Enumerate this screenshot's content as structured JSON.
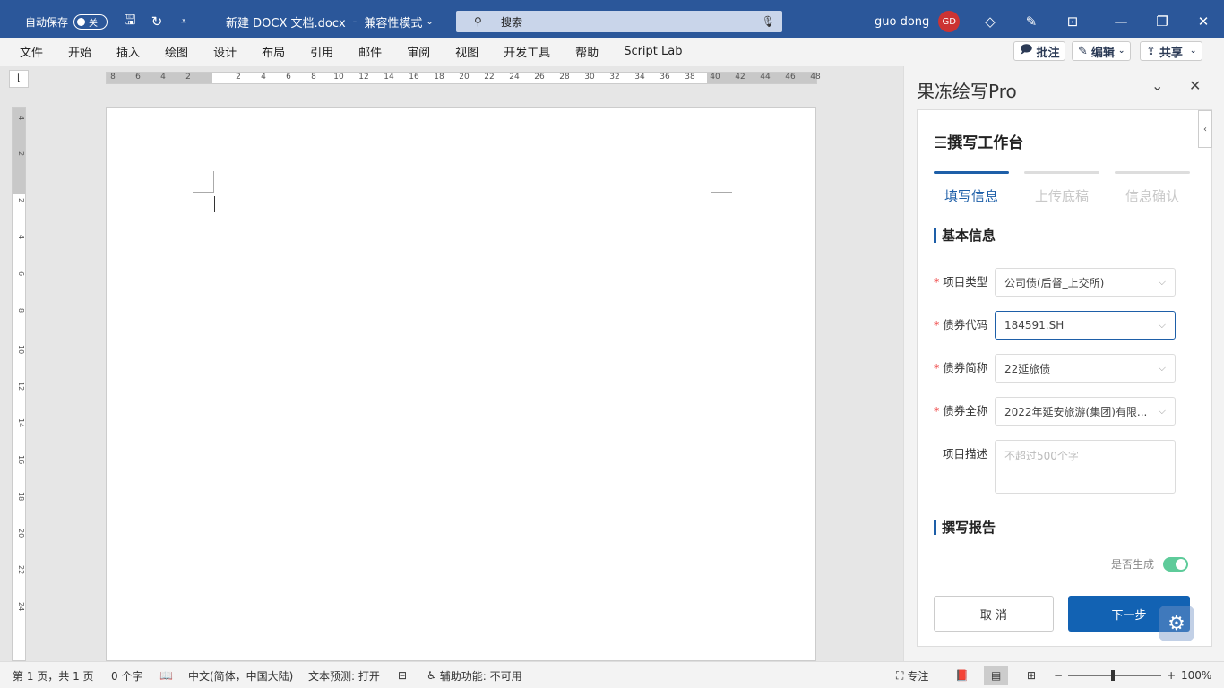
{
  "titlebar": {
    "autosave_label": "自动保存",
    "autosave_state": "关",
    "doc_name": "新建 DOCX 文档.docx",
    "separator": "-",
    "mode": "兼容性模式",
    "search_placeholder": "搜索",
    "user_name": "guo dong",
    "avatar_initials": "GD"
  },
  "ribbon": {
    "tabs": [
      "文件",
      "开始",
      "插入",
      "绘图",
      "设计",
      "布局",
      "引用",
      "邮件",
      "审阅",
      "视图",
      "开发工具",
      "帮助",
      "Script Lab"
    ],
    "comment_btn": "批注",
    "edit_btn": "编辑",
    "share_btn": "共享"
  },
  "ruler": {
    "h_numbers": [
      "8",
      "6",
      "4",
      "2",
      "2",
      "4",
      "6",
      "8",
      "10",
      "12",
      "14",
      "16",
      "18",
      "20",
      "22",
      "24",
      "26",
      "28",
      "30",
      "32",
      "34",
      "36",
      "38",
      "40",
      "42",
      "44",
      "46",
      "48"
    ],
    "v_numbers": [
      "4",
      "2",
      "2",
      "4",
      "6",
      "8",
      "10",
      "12",
      "14",
      "16",
      "18",
      "20",
      "22",
      "24"
    ]
  },
  "pane": {
    "title": "果冻绘写Pro",
    "work_title": "撰写工作台",
    "steps": [
      {
        "label": "填写信息",
        "active": true
      },
      {
        "label": "上传底稿",
        "active": false
      },
      {
        "label": "信息确认",
        "active": false
      }
    ],
    "section_basic": "基本信息",
    "fields": [
      {
        "label": "项目类型",
        "value": "公司债(后督_上交所)",
        "required": true
      },
      {
        "label": "债券代码",
        "value": "184591.SH",
        "required": true
      },
      {
        "label": "债券简称",
        "value": "22延旅债",
        "required": true
      },
      {
        "label": "债券全称",
        "value": "2022年延安旅游(集团)有限...",
        "required": true
      }
    ],
    "desc_label": "项目描述",
    "desc_placeholder": "不超过500个字",
    "section_report": "撰写报告",
    "gen_label": "是否生成",
    "gen_on": true,
    "cancel_btn": "取 消",
    "next_btn": "下一步"
  },
  "status": {
    "page": "第 1 页，共 1 页",
    "words": "0 个字",
    "lang": "中文(简体，中国大陆)",
    "predict": "文本预测: 打开",
    "access": "辅助功能: 不可用",
    "focus": "专注",
    "zoom": "100%"
  },
  "colors": {
    "brand": "#2b579a",
    "accent": "#1e5fa8",
    "switch": "#5ecb9a"
  }
}
